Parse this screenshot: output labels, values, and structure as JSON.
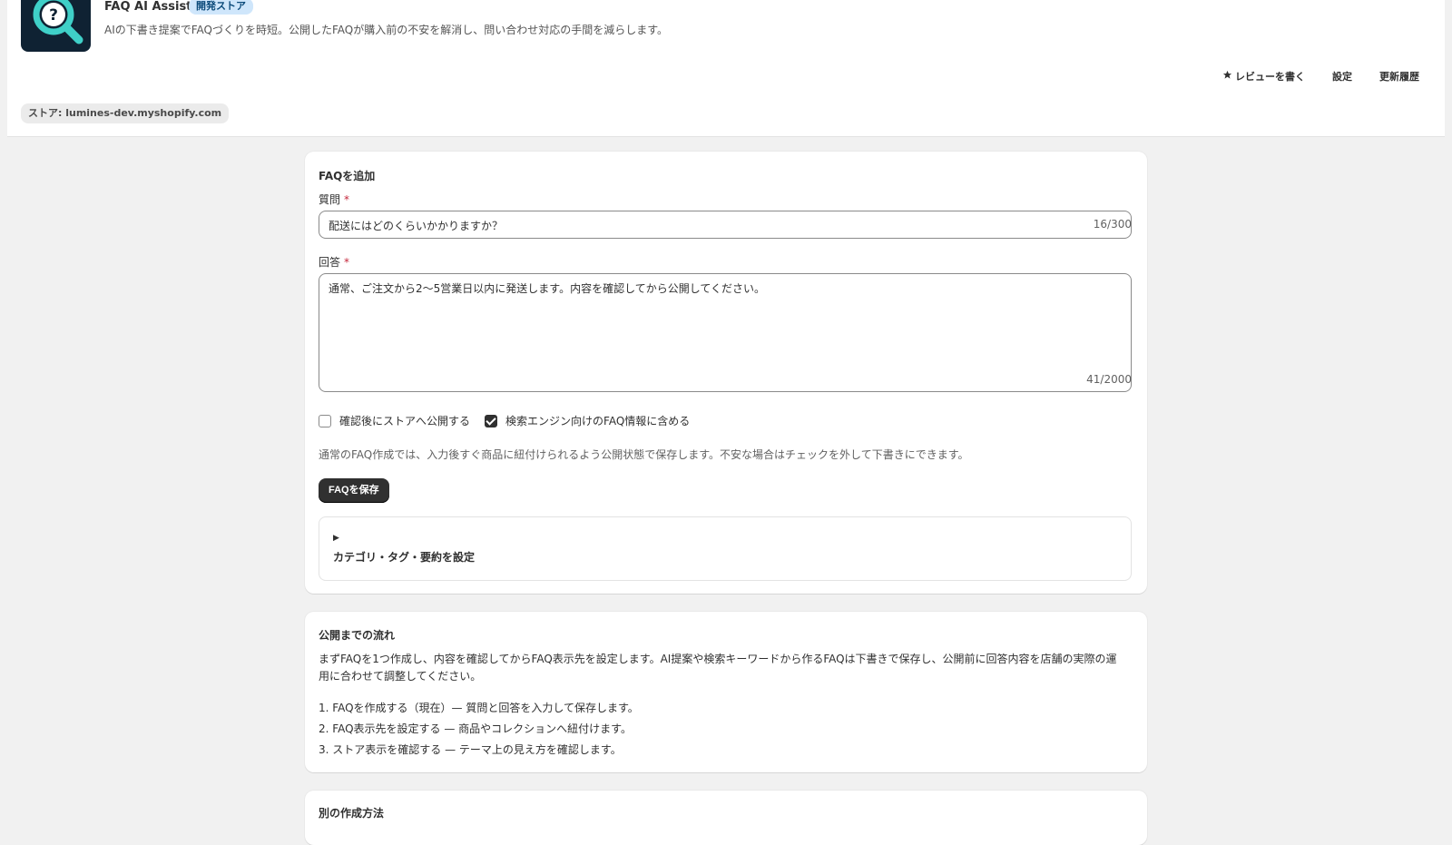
{
  "header": {
    "app_name": "FAQ AI Assist",
    "badge": "開発ストア",
    "description": "AIの下書き提案でFAQづくりを時短。公開したFAQが購入前の不安を解消し、問い合わせ対応の手間を減らします。",
    "actions": [
      {
        "label": "レビューを書く",
        "icon": "star-icon"
      },
      {
        "label": "設定"
      },
      {
        "label": "更新履歴"
      }
    ],
    "store": "ストア: lumines-dev.myshopify.com",
    "colors": {
      "icon_bg": "#0f2233",
      "icon_accent": "#3fd0c8",
      "badge_bg": "#cfe6fb"
    }
  },
  "faq_form": {
    "title": "FAQを追加",
    "question_label": "質問",
    "question_value": "配送にはどのくらいかかりますか？",
    "question_counter": "16/300",
    "answer_label": "回答",
    "answer_value": "通常、ご注文から2〜5営業日以内に発送します。内容を確認してから公開してください。",
    "answer_counter": "41/2000",
    "required_mark": "*",
    "check_publish": {
      "label": "確認後にストアへ公開する",
      "checked": false
    },
    "check_seo": {
      "label": "検索エンジン向けのFAQ情報に含める",
      "checked": true
    },
    "help_text": "通常のFAQ作成では、入力後すぐ商品に紐付けられるよう公開状態で保存します。不安な場合はチェックを外して下書きにできます。",
    "save_label": "FAQを保存",
    "details_arrow": "▶",
    "details_label": "カテゴリ・タグ・要約を設定"
  },
  "flow": {
    "title": "公開までの流れ",
    "description": "まずFAQを1つ作成し、内容を確認してからFAQ表示先を設定します。AI提案や検索キーワードから作るFAQは下書きで保存し、公開前に回答内容を店舗の実際の運用に合わせて調整してください。",
    "steps": [
      "1. FAQを作成する（現在）— 質問と回答を入力して保存します。",
      "2. FAQ表示先を設定する — 商品やコレクションへ紐付けます。",
      "3. ストア表示を確認する — テーマ上の見え方を確認します。"
    ]
  },
  "other": {
    "title": "別の作成方法"
  }
}
